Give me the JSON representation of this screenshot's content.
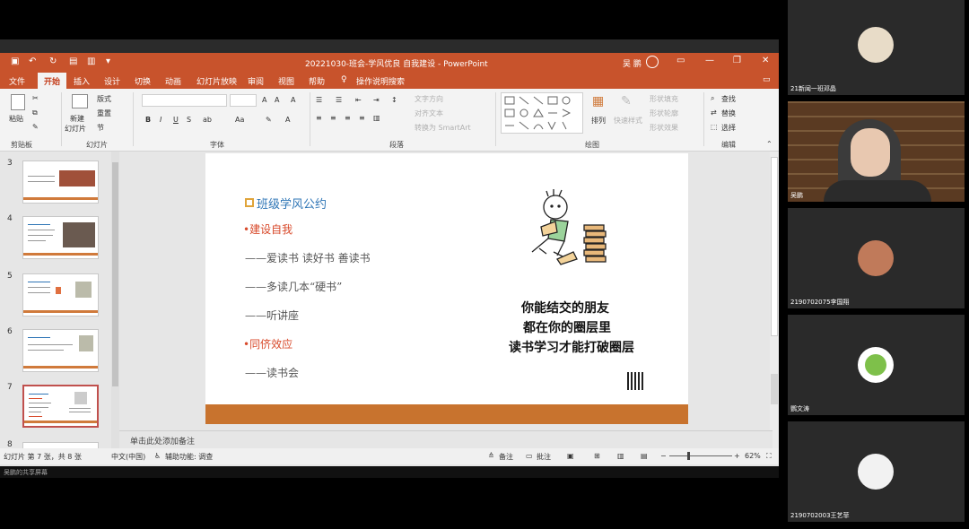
{
  "window": {
    "title": "20221030-班会-学风优良 自我建设 - PowerPoint",
    "user_name": "吴 鹏",
    "colors": {
      "accent": "#c8532c",
      "slide_band": "#c8732e",
      "heading_blue": "#2e75b6",
      "red": "#d84a2b"
    }
  },
  "tabs": [
    "文件",
    "开始",
    "插入",
    "设计",
    "切换",
    "动画",
    "幻灯片放映",
    "审阅",
    "视图",
    "帮助",
    "操作说明搜索"
  ],
  "ribbon": {
    "clipboard": {
      "paste": "粘贴",
      "group": "剪贴板"
    },
    "slides": {
      "new_slide": "新建",
      "new_slide2": "幻灯片",
      "layout": "版式",
      "reset": "重置",
      "section": "节",
      "group": "幻灯片"
    },
    "font": {
      "bold": "B",
      "italic": "I",
      "underline": "U",
      "strike": "S",
      "group": "字体"
    },
    "paragraph": {
      "text_dir": "文字方向",
      "align_text": "对齐文本",
      "smartart": "转换为 SmartArt",
      "group": "段落"
    },
    "drawing": {
      "arrange": "排列",
      "quick_styles": "快速样式",
      "shape_fill": "形状填充",
      "shape_outline": "形状轮廓",
      "shape_effects": "形状效果",
      "group": "绘图"
    },
    "editing": {
      "find": "查找",
      "replace": "替换",
      "select": "选择",
      "group": "编辑"
    }
  },
  "thumbnails": [
    {
      "num": "3"
    },
    {
      "num": "4"
    },
    {
      "num": "5"
    },
    {
      "num": "6"
    },
    {
      "num": "7",
      "selected": true
    },
    {
      "num": "8"
    }
  ],
  "slide": {
    "heading": "班级学风公约",
    "items": [
      {
        "text": "•建设自我",
        "style": "red"
      },
      {
        "text": "——爱读书  读好书  善读书",
        "style": "gray"
      },
      {
        "text": "——多读几本“硬书”",
        "style": "gray"
      },
      {
        "text": "——听讲座",
        "style": "gray"
      },
      {
        "text": "•同侪效应",
        "style": "red"
      },
      {
        "text": "——读书会",
        "style": "gray"
      }
    ],
    "handwriting": [
      "你能结交的朋友",
      "都在你的圈层里",
      "读书学习才能打破圈层"
    ]
  },
  "notes_placeholder": "单击此处添加备注",
  "status": {
    "slide_count": "幻灯片 第 7 张，共 8 张",
    "language": "中文(中国)",
    "accessibility": "辅助功能: 调查",
    "notes": "备注",
    "comments": "批注",
    "zoom": "62%"
  },
  "share_label": "吴鹏的共享屏幕",
  "participants": [
    {
      "name": "21新闻一班邓晶"
    },
    {
      "name": "吴鹏"
    },
    {
      "name": "2190702075李国翔"
    },
    {
      "name": "鹦文涛"
    },
    {
      "name": "2190702003王艺菲"
    }
  ]
}
